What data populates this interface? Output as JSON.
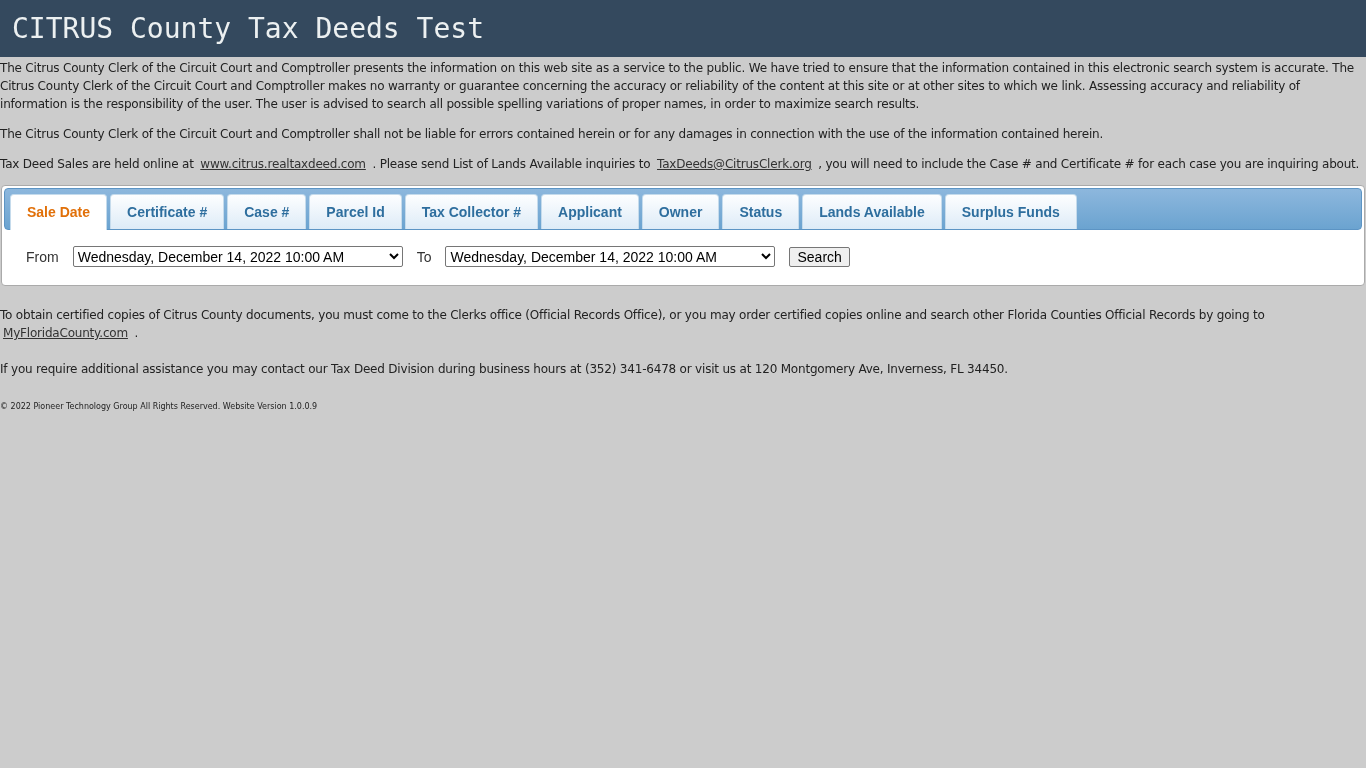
{
  "header": {
    "title": "CITRUS County Tax Deeds Test"
  },
  "disclaimer": [
    "The Citrus County Clerk of the Circuit Court and Comptroller presents the information on this web site as a service to the public. We have tried to ensure that the information contained in this electronic search system is accurate. The Citrus County Clerk of the Circuit Court and Comptroller makes no warranty or guarantee concerning the accuracy or reliability of the content at this site or at other sites to which we link. Assessing accuracy and reliability of information is the responsibility of the user. The user is advised to search all possible spelling variations of proper names, in order to maximize search results.",
    "The Citrus County Clerk of the Circuit Court and Comptroller shall not be liable for errors contained herein or for any damages in connection with the use of the information contained herein."
  ],
  "sales_note": [
    {
      "kind": "text",
      "text": "Tax Deed Sales are held online at "
    },
    {
      "kind": "link",
      "text": "www.citrus.realtaxdeed.com"
    },
    {
      "kind": "text",
      "text": " . Please send List of Lands Available inquiries to "
    },
    {
      "kind": "link",
      "text": "TaxDeeds@CitrusClerk.org"
    },
    {
      "kind": "text",
      "text": " , you will need to include the Case # and Certificate # for each case you are inquiring about."
    }
  ],
  "tabs": [
    {
      "label": "Sale Date",
      "selected": true
    },
    {
      "label": "Certificate #",
      "selected": false
    },
    {
      "label": "Case #",
      "selected": false
    },
    {
      "label": "Parcel Id",
      "selected": false
    },
    {
      "label": "Tax Collector #",
      "selected": false
    },
    {
      "label": "Applicant",
      "selected": false
    },
    {
      "label": "Owner",
      "selected": false
    },
    {
      "label": "Status",
      "selected": false
    },
    {
      "label": "Lands Available",
      "selected": false
    },
    {
      "label": "Surplus Funds",
      "selected": false
    }
  ],
  "search_form": {
    "from_label": "From",
    "from_value": "Wednesday, December 14, 2022 10:00 AM",
    "to_label": "To",
    "to_value": "Wednesday, December 14, 2022 10:00 AM",
    "button": "Search"
  },
  "copies_note": [
    {
      "kind": "text",
      "text": "To obtain certified copies of Citrus County documents, you must come to the Clerks office (Official Records Office), or you may order certified copies online and search other Florida Counties Official Records by going to "
    },
    {
      "kind": "link",
      "text": "MyFloridaCounty.com"
    },
    {
      "kind": "text",
      "text": " ."
    }
  ],
  "assistance": "If you require additional assistance you may contact our Tax Deed Division during business hours at (352) 341-6478 or visit us at 120 Montgomery Ave, Inverness, FL 34450.",
  "footer": "© 2022 Pioneer Technology Group All Rights Reserved. Website Version 1.0.0.9"
}
